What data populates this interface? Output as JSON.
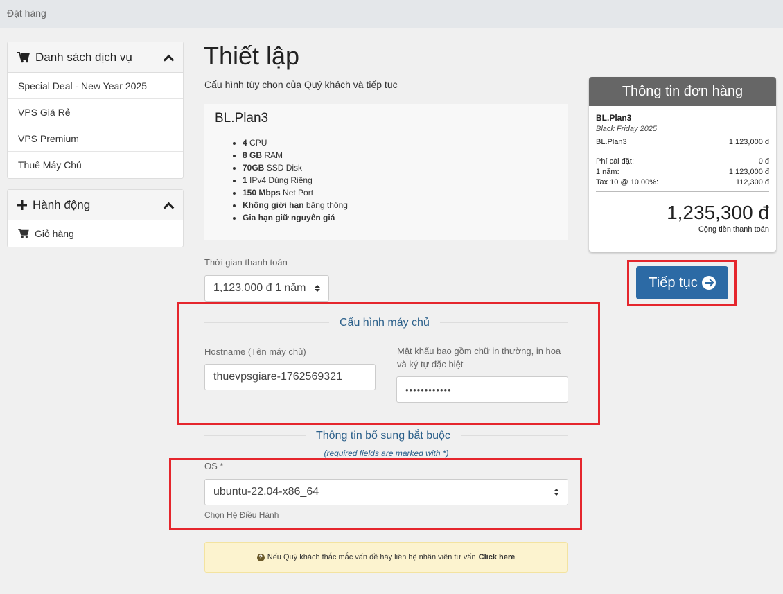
{
  "breadcrumb": "Đặt hàng",
  "sidebar": {
    "services": {
      "title": "Danh sách dịch vụ",
      "items": [
        "Special Deal - New Year 2025",
        "VPS Giá Rẻ",
        "VPS Premium",
        "Thuê Máy Chủ"
      ]
    },
    "actions": {
      "title": "Hành động",
      "items": [
        "Giỏ hàng"
      ]
    }
  },
  "main": {
    "title": "Thiết lập",
    "subtitle": "Cấu hình tùy chọn của Quý khách và tiếp tục",
    "product": {
      "name": "BL.Plan3",
      "features": [
        {
          "bold": "4",
          "text": " CPU"
        },
        {
          "bold": "8 GB",
          "text": " RAM"
        },
        {
          "bold": "70GB",
          "text": " SSD Disk"
        },
        {
          "bold": "1",
          "text": " IPv4 Dùng Riêng"
        },
        {
          "bold": "150 Mbps",
          "text": " Net Port"
        },
        {
          "bold": "Không giới hạn",
          "text": " băng thông"
        },
        {
          "bold": "Gia hạn giữ nguyên giá",
          "text": ""
        }
      ]
    },
    "billing": {
      "label": "Thời gian thanh toán",
      "value": "1,123,000 đ 1 năm"
    },
    "server_config": {
      "title": "Cấu hình máy chủ",
      "hostname_label": "Hostname (Tên máy chủ)",
      "hostname_value": "thuevpsgiare-1762569321",
      "password_label": "Mật khẩu bao gồm chữ in thường, in hoa và ký tự đặc biệt",
      "password_value": "••••••••••••"
    },
    "additional": {
      "title": "Thông tin bổ sung bắt buộc",
      "required_note": "(required fields are marked with *)",
      "os_label": "OS *",
      "os_value": "ubuntu-22.04-x86_64",
      "os_help": "Chọn Hệ Điều Hành"
    },
    "note": {
      "text": "Nếu Quý khách thắc mắc vấn đề hãy liên hệ nhân viên tư vấn",
      "link": "Click here"
    }
  },
  "summary": {
    "title": "Thông tin đơn hàng",
    "product_name": "BL.Plan3",
    "product_group": "Black Friday 2025",
    "line_item_label": "BL.Plan3",
    "line_item_value": "1,123,000 đ",
    "setup_label": "Phí cài đặt:",
    "setup_value": "0 đ",
    "term_label": "1 năm:",
    "term_value": "1,123,000 đ",
    "tax_label": "Tax 10 @ 10.00%:",
    "tax_value": "112,300 đ",
    "total": "1,235,300 đ",
    "total_label": "Cộng tiền thanh toán",
    "continue_label": "Tiếp tục"
  },
  "colors": {
    "accent": "#2c6aa5",
    "highlight": "#e5262d",
    "section_title": "#2a5f8a"
  }
}
